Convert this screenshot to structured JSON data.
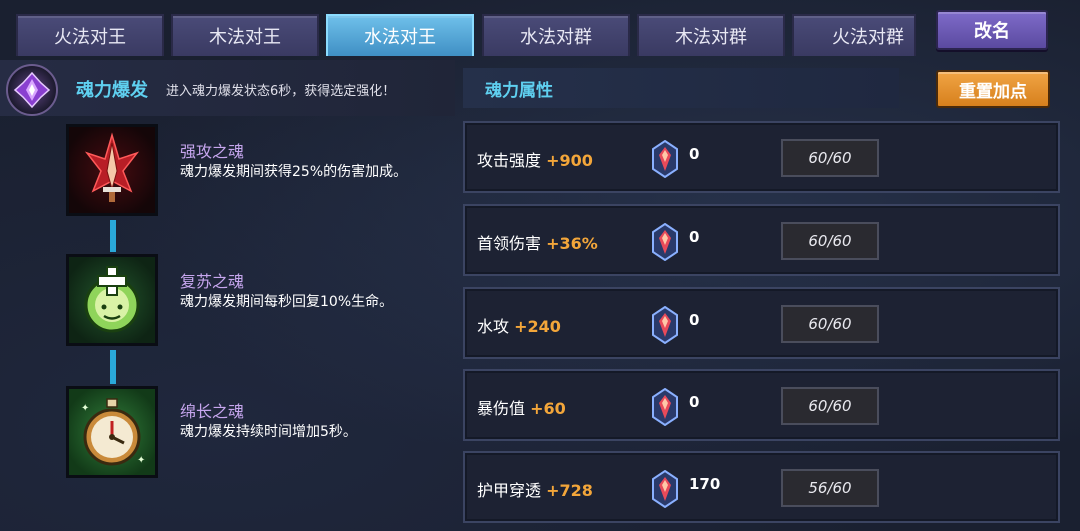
{
  "tabs": [
    {
      "label": "火法对王",
      "active": false
    },
    {
      "label": "木法对王",
      "active": false
    },
    {
      "label": "水法对王",
      "active": true
    },
    {
      "label": "水法对群",
      "active": false
    },
    {
      "label": "木法对群",
      "active": false
    },
    {
      "label": "火法对群",
      "active": false
    }
  ],
  "rename_label": "改名",
  "burst": {
    "title": "魂力爆发",
    "description": "进入魂力爆发状态6秒，获得选定强化！",
    "icon": "purple-crystal-icon"
  },
  "souls": [
    {
      "name": "强攻之魂",
      "description": "魂力爆发期间获得25%的伤害加成。",
      "icon": "red-sword-icon",
      "color": "#c0282a"
    },
    {
      "name": "复苏之魂",
      "description": "魂力爆发期间每秒回复10%生命。",
      "icon": "green-heal-icon",
      "color": "#2f8a3a"
    },
    {
      "name": "绵长之魂",
      "description": "魂力爆发持续时间增加5秒。",
      "icon": "stopwatch-icon",
      "color": "#2d8a3e"
    }
  ],
  "attributes_title": "魂力属性",
  "reset_label": "重置加点",
  "attributes": [
    {
      "name": "攻击强度",
      "bonus": "+900",
      "gems": "0",
      "points": "60/60"
    },
    {
      "name": "首领伤害",
      "bonus": "+36%",
      "gems": "0",
      "points": "60/60"
    },
    {
      "name": "水攻",
      "bonus": "+240",
      "gems": "0",
      "points": "60/60"
    },
    {
      "name": "暴伤值",
      "bonus": "+60",
      "gems": "0",
      "points": "60/60"
    },
    {
      "name": "护甲穿透",
      "bonus": "+728",
      "gems": "170",
      "points": "56/60"
    }
  ],
  "colors": {
    "accent_cyan": "#5fd0f0",
    "bonus_orange": "#f3a63a",
    "active_tab": "#4fa8dc",
    "soul_name": "#c6a6ee"
  }
}
